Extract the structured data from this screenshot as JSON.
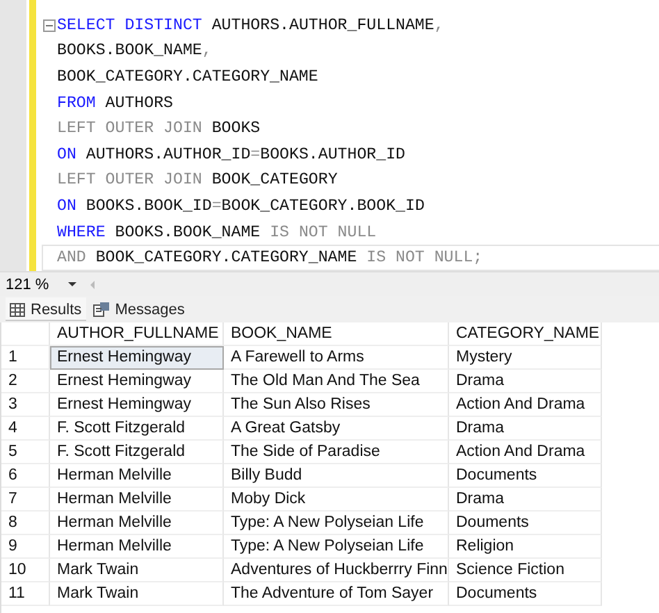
{
  "editor": {
    "lines": [
      {
        "collapse": true,
        "current": false,
        "tokens": [
          {
            "text": "SELECT DISTINCT",
            "kind": "keyword"
          },
          {
            "text": " AUTHORS.AUTHOR_FULLNAME",
            "kind": "ident"
          },
          {
            "text": ",",
            "kind": "operator"
          }
        ]
      },
      {
        "collapse": false,
        "current": false,
        "tokens": [
          {
            "text": "BOOKS.BOOK_NAME",
            "kind": "ident"
          },
          {
            "text": ",",
            "kind": "operator"
          }
        ]
      },
      {
        "collapse": false,
        "current": false,
        "tokens": [
          {
            "text": "BOOK_CATEGORY.CATEGORY_NAME",
            "kind": "ident"
          }
        ]
      },
      {
        "collapse": false,
        "current": false,
        "tokens": [
          {
            "text": "FROM",
            "kind": "keyword"
          },
          {
            "text": " AUTHORS",
            "kind": "ident"
          }
        ]
      },
      {
        "collapse": false,
        "current": false,
        "tokens": [
          {
            "text": "LEFT OUTER JOIN",
            "kind": "operator"
          },
          {
            "text": " BOOKS",
            "kind": "ident"
          }
        ]
      },
      {
        "collapse": false,
        "current": false,
        "tokens": [
          {
            "text": "ON",
            "kind": "keyword"
          },
          {
            "text": " AUTHORS.AUTHOR_ID",
            "kind": "ident"
          },
          {
            "text": "=",
            "kind": "operator"
          },
          {
            "text": "BOOKS.AUTHOR_ID",
            "kind": "ident"
          }
        ]
      },
      {
        "collapse": false,
        "current": false,
        "tokens": [
          {
            "text": "LEFT OUTER JOIN",
            "kind": "operator"
          },
          {
            "text": " BOOK_CATEGORY",
            "kind": "ident"
          }
        ]
      },
      {
        "collapse": false,
        "current": false,
        "tokens": [
          {
            "text": "ON",
            "kind": "keyword"
          },
          {
            "text": " BOOKS.BOOK_ID",
            "kind": "ident"
          },
          {
            "text": "=",
            "kind": "operator"
          },
          {
            "text": "BOOK_CATEGORY.BOOK_ID",
            "kind": "ident"
          }
        ]
      },
      {
        "collapse": false,
        "current": false,
        "tokens": [
          {
            "text": "WHERE",
            "kind": "keyword"
          },
          {
            "text": " BOOKS.BOOK_NAME ",
            "kind": "ident"
          },
          {
            "text": "IS NOT NULL",
            "kind": "operator"
          }
        ]
      },
      {
        "collapse": false,
        "current": true,
        "tokens": [
          {
            "text": "AND",
            "kind": "operator"
          },
          {
            "text": " BOOK_CATEGORY.CATEGORY_NAME ",
            "kind": "ident"
          },
          {
            "text": "IS NOT NULL;",
            "kind": "operator"
          }
        ]
      }
    ]
  },
  "zoom": {
    "value": "121 %"
  },
  "tabs": [
    {
      "label": "Results",
      "kind": "grid",
      "selected": true
    },
    {
      "label": "Messages",
      "kind": "messages",
      "selected": false
    }
  ],
  "table": {
    "columns": [
      "AUTHOR_FULLNAME",
      "BOOK_NAME",
      "CATEGORY_NAME"
    ],
    "rows": [
      {
        "number": "1",
        "cells": [
          {
            "text": "Ernest Hemingway",
            "selected": true
          },
          {
            "text": "A Farewell to Arms",
            "selected": false
          },
          {
            "text": "Mystery",
            "selected": false
          }
        ]
      },
      {
        "number": "2",
        "cells": [
          {
            "text": "Ernest Hemingway",
            "selected": false
          },
          {
            "text": "The Old Man And The Sea",
            "selected": false
          },
          {
            "text": "Drama",
            "selected": false
          }
        ]
      },
      {
        "number": "3",
        "cells": [
          {
            "text": "Ernest Hemingway",
            "selected": false
          },
          {
            "text": "The Sun Also Rises",
            "selected": false
          },
          {
            "text": "Action And Drama",
            "selected": false
          }
        ]
      },
      {
        "number": "4",
        "cells": [
          {
            "text": "F. Scott Fitzgerald",
            "selected": false
          },
          {
            "text": "A Great Gatsby",
            "selected": false
          },
          {
            "text": "Drama",
            "selected": false
          }
        ]
      },
      {
        "number": "5",
        "cells": [
          {
            "text": "F. Scott Fitzgerald",
            "selected": false
          },
          {
            "text": "The Side of Paradise",
            "selected": false
          },
          {
            "text": "Action And Drama",
            "selected": false
          }
        ]
      },
      {
        "number": "6",
        "cells": [
          {
            "text": "Herman Melville",
            "selected": false
          },
          {
            "text": "Billy Budd",
            "selected": false
          },
          {
            "text": "Documents",
            "selected": false
          }
        ]
      },
      {
        "number": "7",
        "cells": [
          {
            "text": "Herman Melville",
            "selected": false
          },
          {
            "text": "Moby Dick",
            "selected": false
          },
          {
            "text": "Drama",
            "selected": false
          }
        ]
      },
      {
        "number": "8",
        "cells": [
          {
            "text": "Herman Melville",
            "selected": false
          },
          {
            "text": "Type: A New Polyseian Life",
            "selected": false
          },
          {
            "text": "Douments",
            "selected": false
          }
        ]
      },
      {
        "number": "9",
        "cells": [
          {
            "text": "Herman Melville",
            "selected": false
          },
          {
            "text": "Type: A New Polyseian Life",
            "selected": false
          },
          {
            "text": "Religion",
            "selected": false
          }
        ]
      },
      {
        "number": "10",
        "cells": [
          {
            "text": "Mark Twain",
            "selected": false
          },
          {
            "text": "Adventures of Huckberrry Finn",
            "selected": false
          },
          {
            "text": "Science Fiction",
            "selected": false
          }
        ]
      },
      {
        "number": "11",
        "cells": [
          {
            "text": "Mark Twain",
            "selected": false
          },
          {
            "text": "The Adventure of Tom Sayer",
            "selected": false
          },
          {
            "text": "Documents",
            "selected": false
          }
        ]
      }
    ]
  }
}
